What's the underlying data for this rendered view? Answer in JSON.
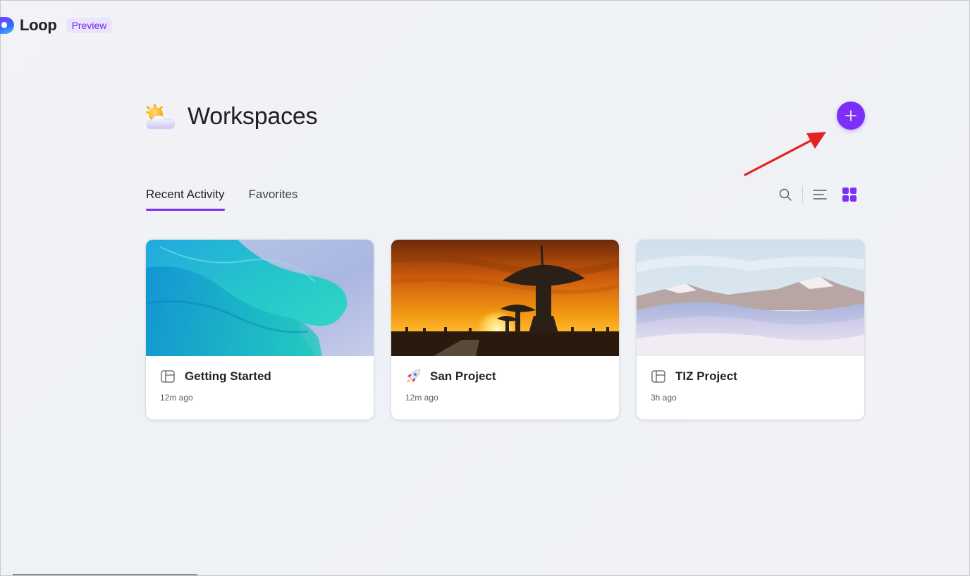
{
  "app": {
    "name": "Loop",
    "badge": "Preview"
  },
  "page": {
    "title": "Workspaces",
    "title_icon": "sun-behind-cloud-icon",
    "add_button_icon": "plus-icon",
    "add_button_color": "#7b2ff7"
  },
  "tabs": [
    {
      "label": "Recent Activity",
      "active": true
    },
    {
      "label": "Favorites",
      "active": false
    }
  ],
  "toolbar": {
    "icons": [
      "search-icon",
      "list-view-icon",
      "grid-view-icon"
    ],
    "active_view": "grid"
  },
  "annotation": {
    "type": "red-arrow",
    "color": "#e32222",
    "points_to": "add-workspace-button"
  },
  "cards": [
    {
      "title": "Getting Started",
      "time": "12m ago",
      "icon": "page-layout-icon",
      "cover": "teal-fabric"
    },
    {
      "title": "San Project",
      "time": "12m ago",
      "icon": "rocket-icon",
      "cover": "radio-telescope-sunset"
    },
    {
      "title": "TIZ Project",
      "time": "3h ago",
      "icon": "page-layout-icon",
      "cover": "snowy-dunes"
    }
  ]
}
